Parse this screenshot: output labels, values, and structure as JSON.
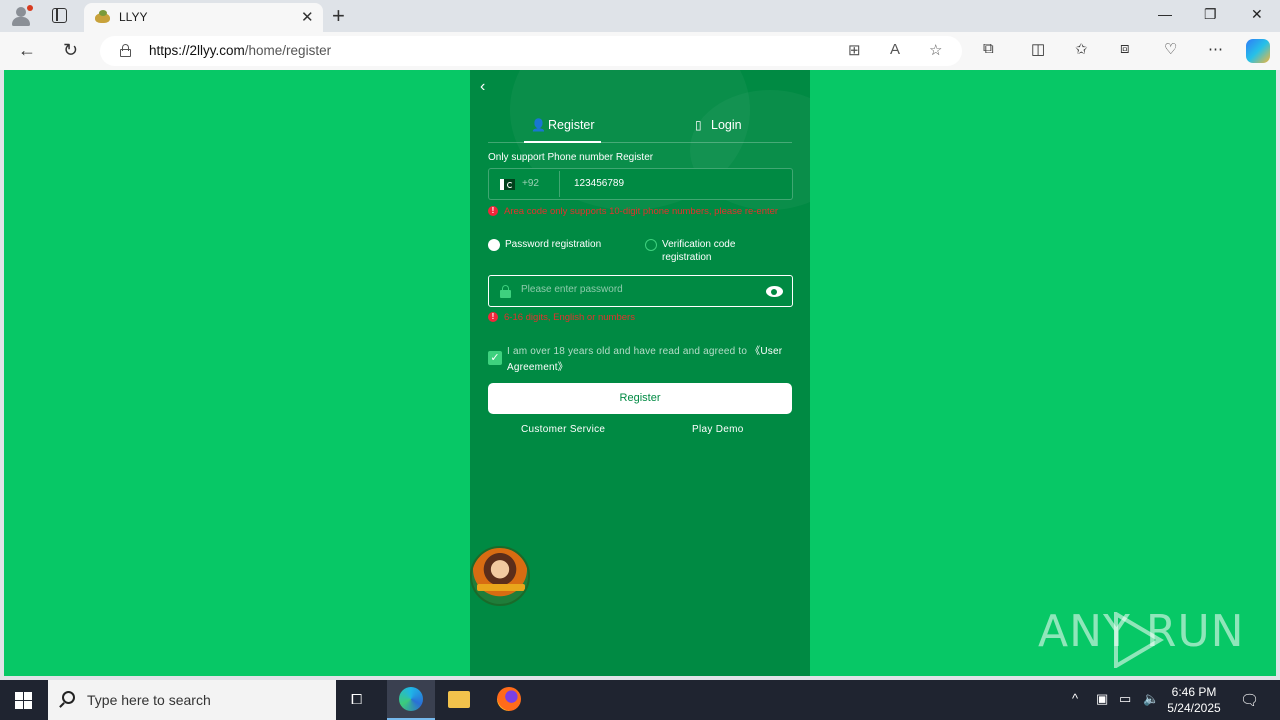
{
  "browser": {
    "tab_title": "LLYY",
    "url_host": "https://2llyy.com",
    "url_path": "/home/register"
  },
  "page": {
    "tabs": [
      {
        "label": "Register",
        "active": true
      },
      {
        "label": "Login",
        "active": false
      }
    ],
    "phone_hint": "Only support Phone number Register",
    "country_code": "+92",
    "phone_value": "123456789",
    "phone_error": "Area code only supports 10-digit phone numbers, please re-enter",
    "reg_options": {
      "password": "Password registration",
      "verification": "Verification code registration"
    },
    "password_placeholder": "Please enter password",
    "password_error": "6-16 digits, English or numbers",
    "agreement_text": "I am over 18 years old and have read and agreed to",
    "agreement_link": "《User Agreement》",
    "register_button": "Register",
    "customer_service": "Customer Service",
    "play_demo": "Play Demo"
  },
  "watermark": "ANY RUN",
  "taskbar": {
    "search_placeholder": "Type here to search",
    "time": "6:46 PM",
    "date": "5/24/2025"
  },
  "colors": {
    "page_bg": "#07c866",
    "panel_bg": "#008a43",
    "error": "#e2322c"
  }
}
